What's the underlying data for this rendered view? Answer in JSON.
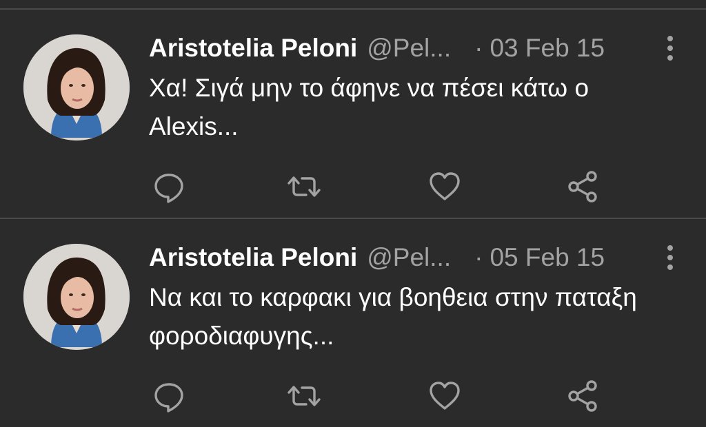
{
  "tweets": [
    {
      "author_name": "Aristotelia Peloni",
      "handle": "@Pel...",
      "separator": "·",
      "date": "03 Feb 15",
      "text": "Χα! Σιγά μην το άφηνε να πέσει κάτω ο Alexis..."
    },
    {
      "author_name": "Aristotelia Peloni",
      "handle": "@Pel...",
      "separator": "·",
      "date": "05 Feb 15",
      "text": "Να και το καρφακι για βοηθεια στην παταξη φοροδιαφυγης..."
    }
  ],
  "icons": {
    "reply": "speech-bubble",
    "retweet": "two-arrows-loop",
    "like": "heart-outline",
    "share": "share-nodes",
    "more": "vertical-ellipsis"
  },
  "colors": {
    "background": "#2b2b2b",
    "divider": "#4a4a4a",
    "primary_text": "#ffffff",
    "secondary_text": "#a3a3a3",
    "icon": "#a3a3a3"
  }
}
